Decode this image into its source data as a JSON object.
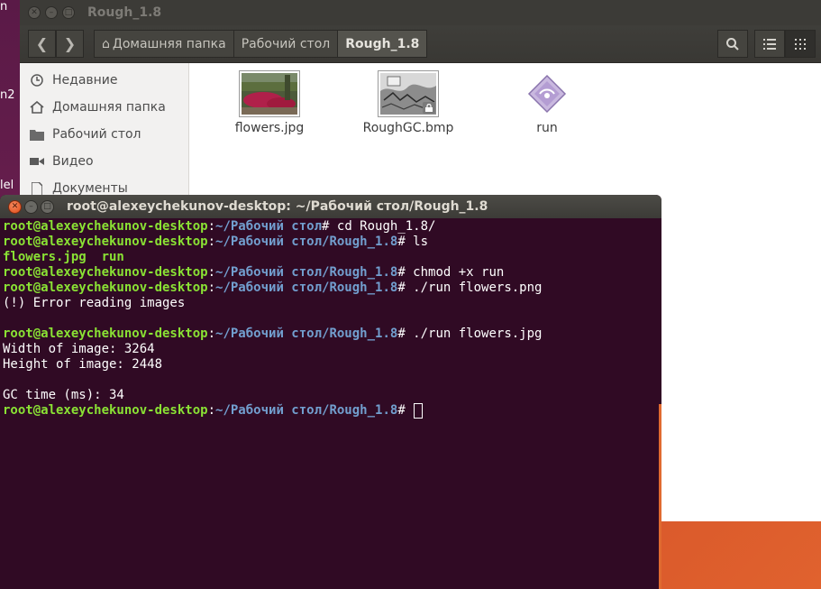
{
  "desktop": {
    "edge_labels": [
      "n",
      "n2",
      "lel"
    ]
  },
  "file_manager": {
    "title": "Rough_1.8",
    "nav": {
      "back_icon": "chevron-left-icon",
      "forward_icon": "chevron-right-icon"
    },
    "breadcrumbs": [
      {
        "label": "Домашняя папка",
        "icon": "home-icon"
      },
      {
        "label": "Рабочий стол"
      },
      {
        "label": "Rough_1.8",
        "active": true
      }
    ],
    "toolbar": {
      "search_icon": "search-icon",
      "list_view_icon": "list-view-icon",
      "grid_view_icon": "grid-view-icon"
    },
    "sidebar": [
      {
        "label": "Недавние",
        "icon": "clock-icon"
      },
      {
        "label": "Домашняя папка",
        "icon": "home-icon"
      },
      {
        "label": "Рабочий стол",
        "icon": "folder-icon"
      },
      {
        "label": "Видео",
        "icon": "film-icon"
      },
      {
        "label": "Документы",
        "icon": "document-icon"
      }
    ],
    "files": [
      {
        "name": "flowers.jpg",
        "kind": "image-thumbnail"
      },
      {
        "name": "RoughGC.bmp",
        "kind": "image-thumbnail-locked"
      },
      {
        "name": "run",
        "kind": "executable"
      }
    ]
  },
  "terminal": {
    "title": "root@alexeychekunov-desktop: ~/Рабочий стол/Rough_1.8",
    "lines": [
      {
        "user": "root@alexeychekunov-desktop",
        "path": "~/Рабочий стол",
        "cmd": "# cd Rough_1.8/"
      },
      {
        "user": "root@alexeychekunov-desktop",
        "path": "~/Рабочий стол/Rough_1.8",
        "cmd": "# ls"
      },
      {
        "text": "flowers.jpg  run",
        "color": "#8ae234"
      },
      {
        "user": "root@alexeychekunov-desktop",
        "path": "~/Рабочий стол/Rough_1.8",
        "cmd": "# chmod +x run"
      },
      {
        "user": "root@alexeychekunov-desktop",
        "path": "~/Рабочий стол/Rough_1.8",
        "cmd": "# ./run flowers.png"
      },
      {
        "text": "(!) Error reading images"
      },
      {
        "text": ""
      },
      {
        "user": "root@alexeychekunov-desktop",
        "path": "~/Рабочий стол/Rough_1.8",
        "cmd": "# ./run flowers.jpg"
      },
      {
        "text": "Width of image: 3264"
      },
      {
        "text": "Height of image: 2448"
      },
      {
        "text": ""
      },
      {
        "text": "GC time (ms): 34"
      },
      {
        "user": "root@alexeychekunov-desktop",
        "path": "~/Рабочий стол/Rough_1.8",
        "cmd": "# ",
        "cursor": true
      }
    ]
  },
  "colors": {
    "terminal_bg": "#300a24",
    "prompt_user": "#8ae234",
    "prompt_path": "#729fcf",
    "titlebar": "#3c3b37"
  }
}
